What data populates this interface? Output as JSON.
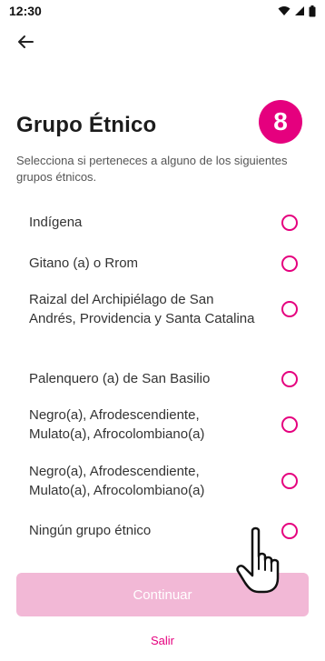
{
  "status_bar": {
    "time": "12:30",
    "icons": [
      "wifi-icon",
      "signal-icon",
      "battery-icon"
    ]
  },
  "header": {
    "back_icon": "arrow-left-icon"
  },
  "step": {
    "number": "8"
  },
  "content": {
    "title": "Grupo Étnico",
    "subtitle": "Selecciona si perteneces a alguno de los siguientes grupos étnicos."
  },
  "options": [
    {
      "label": "Indígena",
      "selected": false
    },
    {
      "label": "Gitano (a) o Rrom",
      "selected": false
    },
    {
      "label": "Raizal del Archipiélago de San Andrés, Providencia y Santa Catalina",
      "selected": false
    },
    {
      "label": "Palenquero (a) de San Basilio",
      "selected": false
    },
    {
      "label": "Negro(a), Afrodescendiente, Mulato(a), Afrocolombiano(a)",
      "selected": false
    },
    {
      "label": "Negro(a), Afrodescendiente, Mulato(a), Afrocolombiano(a)",
      "selected": false
    },
    {
      "label": "Ningún grupo étnico",
      "selected": false
    }
  ],
  "actions": {
    "continue_label": "Continuar",
    "exit_label": "Salir"
  },
  "colors": {
    "accent": "#e5007e",
    "button_disabled": "#f2b8d6"
  }
}
